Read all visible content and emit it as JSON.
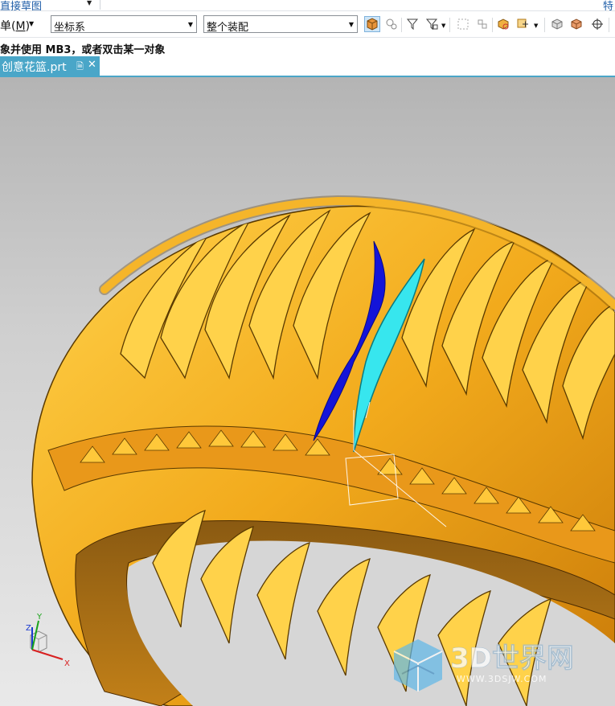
{
  "menubar": {
    "items": [
      {
        "label": "直接草图"
      },
      {
        "label": "特"
      }
    ]
  },
  "toolbar": {
    "menu_label_prefix": "单(",
    "menu_label_key": "M",
    "menu_label_suffix": ")",
    "filter_combo": {
      "value": "坐标系"
    },
    "scope_combo": {
      "value": "整个装配"
    },
    "icons": [
      "select-part-icon",
      "snap-icon",
      "filter-funnel-icon",
      "filter-menu-icon",
      "deselect-icon",
      "component-icon",
      "assembly-icon",
      "plane-icon",
      "point-icon",
      "cube-icon",
      "orange-cube-icon",
      "crosshair-icon"
    ]
  },
  "cue_line": {
    "text": "象并使用 MB3，或者双击某一对象"
  },
  "tab": {
    "title": "创意花篮.prt"
  },
  "triad": {
    "x_label": "X",
    "y_label": "Y",
    "z_label": "Z"
  },
  "watermark": {
    "brand": "3D世界网",
    "url": "WWW.3DSJW.COM"
  },
  "colors": {
    "model_gold": "#f2aa1c",
    "model_edge": "#5a3a00",
    "model_shadow": "#c6780a",
    "selected_blue": "#1414d8",
    "selected_cyan": "#37e6ee",
    "tab_active": "#4aa6c8"
  }
}
